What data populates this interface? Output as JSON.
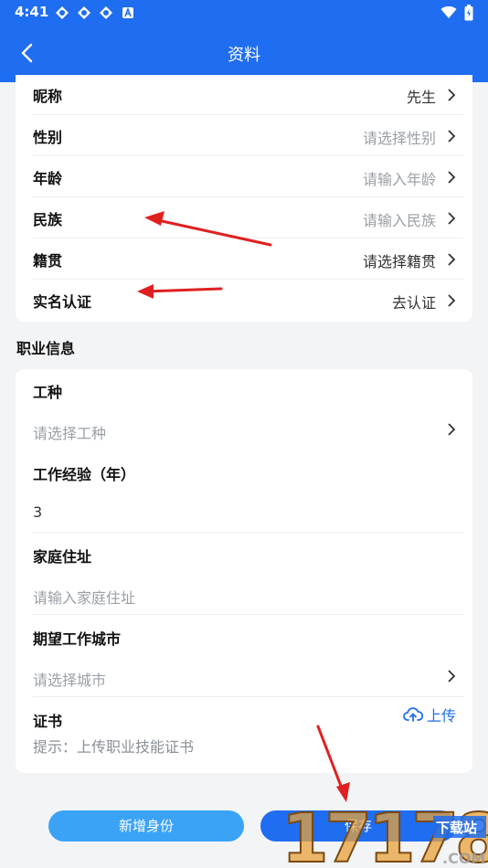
{
  "status_bar": {
    "time": "4:41",
    "icons": [
      "app-icon",
      "app-icon",
      "app-icon",
      "a-badge-icon"
    ],
    "right_icons": [
      "wifi-icon",
      "battery-icon"
    ]
  },
  "header": {
    "title": "资料",
    "back_icon": "chevron-left-icon",
    "background": "#1f6df0"
  },
  "personal": {
    "rows": [
      {
        "label": "昵称",
        "value": "先生",
        "placeholder": false
      },
      {
        "label": "性别",
        "value": "请选择性别",
        "placeholder": true
      },
      {
        "label": "年龄",
        "value": "请输入年龄",
        "placeholder": true
      },
      {
        "label": "民族",
        "value": "请输入民族",
        "placeholder": true
      },
      {
        "label": "籍贯",
        "value": "请选择籍贯",
        "placeholder": false
      },
      {
        "label": "实名认证",
        "value": "去认证",
        "placeholder": false
      }
    ]
  },
  "job": {
    "section_title": "职业信息",
    "work_type": {
      "label": "工种",
      "placeholder": "请选择工种"
    },
    "experience": {
      "label": "工作经验（年）",
      "value": "3"
    },
    "address": {
      "label": "家庭住址",
      "placeholder": "请输入家庭住址"
    },
    "city": {
      "label": "期望工作城市",
      "placeholder": "请选择城市"
    },
    "certificate": {
      "label": "证书",
      "upload_label": "上传",
      "hint": "提示：上传职业技能证书"
    }
  },
  "buttons": {
    "new_identity": "新增身份",
    "save": "保存"
  },
  "colors": {
    "accent": "#1f6df0",
    "secondary_button": "#3ba3f6",
    "annotation_arrow": "#e02020"
  },
  "watermark": {
    "text": "17178",
    "subtext": "下载站",
    "domain": ".COM"
  }
}
